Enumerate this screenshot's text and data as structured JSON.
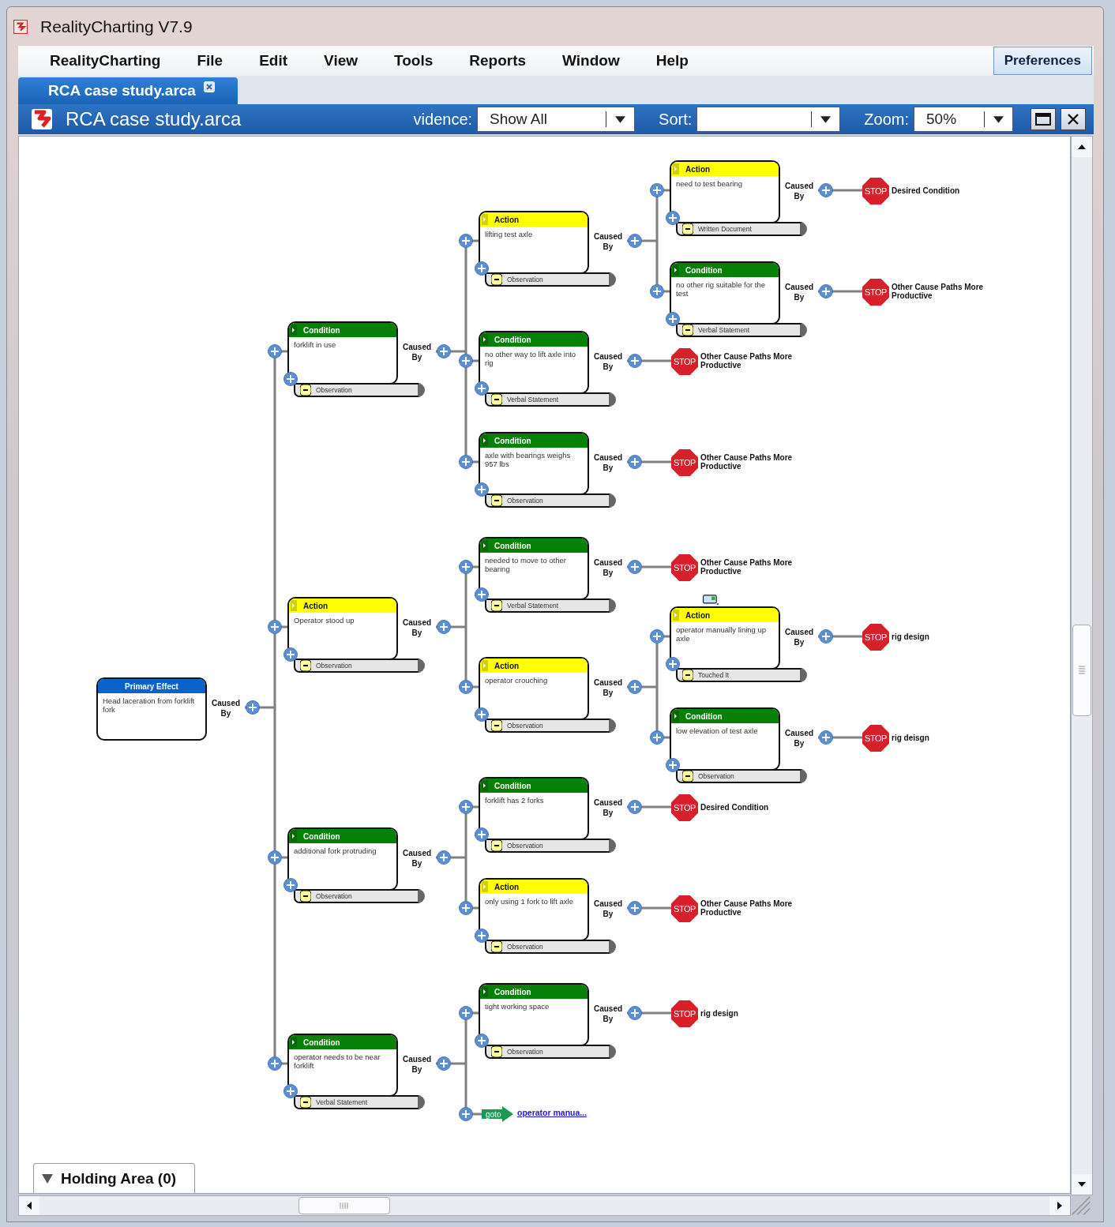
{
  "window": {
    "title": "RealityCharting V7.9"
  },
  "menu": [
    "RealityCharting",
    "File",
    "Edit",
    "View",
    "Tools",
    "Reports",
    "Window",
    "Help"
  ],
  "preferences_button": "Preferences",
  "document_tab": {
    "label": "RCA case study.arca",
    "selected": true
  },
  "toolbar": {
    "title": "RCA case study.arca",
    "evidence_label": "vidence:",
    "evidence_value": "Show All",
    "sort_label": "Sort:",
    "zoom_label": "Zoom:",
    "zoom_value": "50%"
  },
  "chart": {
    "root": {
      "kind": "primary",
      "type": "Primary Effect",
      "text": "Head laceration from forklift fork",
      "link": "Caused By",
      "children": [
        {
          "kind": "condition",
          "type": "Condition",
          "text": "forklift in use",
          "link": "Caused By",
          "evidence": "Observation",
          "children": [
            {
              "kind": "action",
              "type": "Action",
              "text": "lifting test axle",
              "link": "Caused By",
              "evidence": "Observation",
              "children": [
                {
                  "kind": "action",
                  "type": "Action",
                  "text": "need to test bearing",
                  "link": "Caused By",
                  "evidence": "Written Document",
                  "children": [
                    {
                      "kind": "stop",
                      "sign": "STOP",
                      "text": "Desired Condition"
                    }
                  ]
                },
                {
                  "kind": "condition",
                  "type": "Condition",
                  "text": "no other rig suitable for the test",
                  "link": "Caused By",
                  "evidence": "Verbal Statement",
                  "children": [
                    {
                      "kind": "stop",
                      "sign": "STOP",
                      "text": "Other Cause Paths More Productive"
                    }
                  ]
                }
              ]
            },
            {
              "kind": "condition",
              "type": "Condition",
              "text": "no other way to lift axle into rig",
              "link": "Caused By",
              "evidence": "Verbal Statement",
              "children": [
                {
                  "kind": "stop",
                  "sign": "STOP",
                  "text": "Other Cause Paths More Productive"
                }
              ]
            },
            {
              "kind": "condition",
              "type": "Condition",
              "text": "axle with bearings weighs 957 lbs",
              "link": "Caused By",
              "evidence": "Observation",
              "children": [
                {
                  "kind": "stop",
                  "sign": "STOP",
                  "text": "Other Cause Paths More Productive"
                }
              ]
            }
          ]
        },
        {
          "kind": "action",
          "type": "Action",
          "text": "Operator stood up",
          "link": "Caused By",
          "evidence": "Observation",
          "children": [
            {
              "kind": "condition",
              "type": "Condition",
              "text": "needed to move to other bearing",
              "link": "Caused By",
              "evidence": "Verbal Statement",
              "children": [
                {
                  "kind": "stop",
                  "sign": "STOP",
                  "text": "Other Cause Paths More Productive"
                }
              ]
            },
            {
              "kind": "action",
              "type": "Action",
              "text": "operator crouching",
              "link": "Caused By",
              "evidence": "Observation",
              "children": [
                {
                  "kind": "action",
                  "type": "Action",
                  "text": "operator manually lining up axle",
                  "link": "Caused By",
                  "evidence": "Touched It",
                  "attachment": true,
                  "children": [
                    {
                      "kind": "stop",
                      "sign": "STOP",
                      "text": "rig design"
                    }
                  ]
                },
                {
                  "kind": "condition",
                  "type": "Condition",
                  "text": "low elevation of test axle",
                  "link": "Caused By",
                  "evidence": "Observation",
                  "children": [
                    {
                      "kind": "stop",
                      "sign": "STOP",
                      "text": "rig deisgn"
                    }
                  ]
                }
              ]
            }
          ]
        },
        {
          "kind": "condition",
          "type": "Condition",
          "text": "additional fork protruding",
          "link": "Caused By",
          "evidence": "Observation",
          "children": [
            {
              "kind": "condition",
              "type": "Condition",
              "text": "forklift has 2 forks",
              "link": "Caused By",
              "evidence": "Observation",
              "children": [
                {
                  "kind": "stop",
                  "sign": "STOP",
                  "text": "Desired Condition"
                }
              ]
            },
            {
              "kind": "action",
              "type": "Action",
              "text": "only using 1 fork to lift axle",
              "link": "Caused By",
              "evidence": "Observation",
              "children": [
                {
                  "kind": "stop",
                  "sign": "STOP",
                  "text": "Other Cause Paths More Productive"
                }
              ]
            }
          ]
        },
        {
          "kind": "condition",
          "type": "Condition",
          "text": "operator needs to be near forklift",
          "link": "Caused By",
          "evidence": "Verbal Statement",
          "children": [
            {
              "kind": "condition",
              "type": "Condition",
              "text": "tight working space",
              "link": "Caused By",
              "evidence": "Observation",
              "children": [
                {
                  "kind": "stop",
                  "sign": "STOP",
                  "text": "rig design"
                }
              ]
            },
            {
              "kind": "goto",
              "sign": "goto",
              "text": "operator manua..."
            }
          ]
        }
      ]
    }
  },
  "holding_area": {
    "label": "Holding Area (0)",
    "expanded": true
  }
}
